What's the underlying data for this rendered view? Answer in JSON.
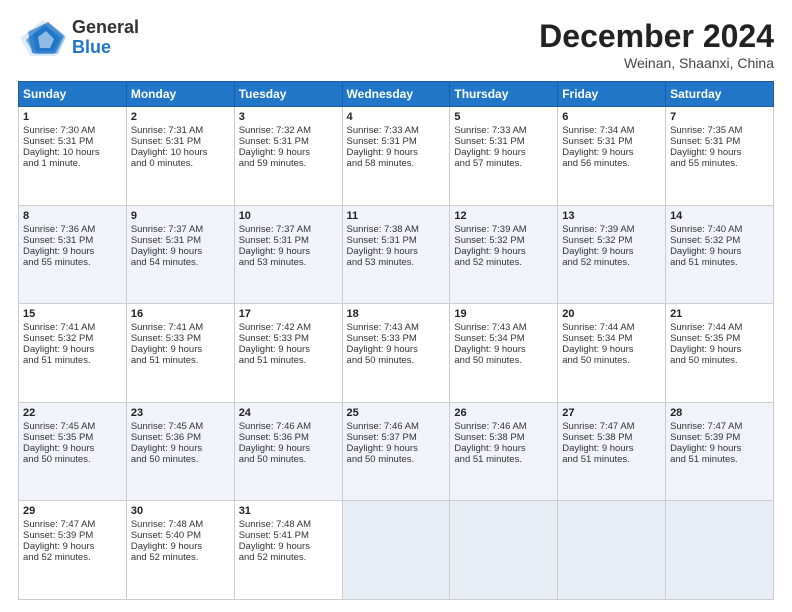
{
  "header": {
    "logo_general": "General",
    "logo_blue": "Blue",
    "month_title": "December 2024",
    "location": "Weinan, Shaanxi, China"
  },
  "days_of_week": [
    "Sunday",
    "Monday",
    "Tuesday",
    "Wednesday",
    "Thursday",
    "Friday",
    "Saturday"
  ],
  "weeks": [
    [
      {
        "day": "1",
        "lines": [
          "Sunrise: 7:30 AM",
          "Sunset: 5:31 PM",
          "Daylight: 10 hours",
          "and 1 minute."
        ]
      },
      {
        "day": "2",
        "lines": [
          "Sunrise: 7:31 AM",
          "Sunset: 5:31 PM",
          "Daylight: 10 hours",
          "and 0 minutes."
        ]
      },
      {
        "day": "3",
        "lines": [
          "Sunrise: 7:32 AM",
          "Sunset: 5:31 PM",
          "Daylight: 9 hours",
          "and 59 minutes."
        ]
      },
      {
        "day": "4",
        "lines": [
          "Sunrise: 7:33 AM",
          "Sunset: 5:31 PM",
          "Daylight: 9 hours",
          "and 58 minutes."
        ]
      },
      {
        "day": "5",
        "lines": [
          "Sunrise: 7:33 AM",
          "Sunset: 5:31 PM",
          "Daylight: 9 hours",
          "and 57 minutes."
        ]
      },
      {
        "day": "6",
        "lines": [
          "Sunrise: 7:34 AM",
          "Sunset: 5:31 PM",
          "Daylight: 9 hours",
          "and 56 minutes."
        ]
      },
      {
        "day": "7",
        "lines": [
          "Sunrise: 7:35 AM",
          "Sunset: 5:31 PM",
          "Daylight: 9 hours",
          "and 55 minutes."
        ]
      }
    ],
    [
      {
        "day": "8",
        "lines": [
          "Sunrise: 7:36 AM",
          "Sunset: 5:31 PM",
          "Daylight: 9 hours",
          "and 55 minutes."
        ]
      },
      {
        "day": "9",
        "lines": [
          "Sunrise: 7:37 AM",
          "Sunset: 5:31 PM",
          "Daylight: 9 hours",
          "and 54 minutes."
        ]
      },
      {
        "day": "10",
        "lines": [
          "Sunrise: 7:37 AM",
          "Sunset: 5:31 PM",
          "Daylight: 9 hours",
          "and 53 minutes."
        ]
      },
      {
        "day": "11",
        "lines": [
          "Sunrise: 7:38 AM",
          "Sunset: 5:31 PM",
          "Daylight: 9 hours",
          "and 53 minutes."
        ]
      },
      {
        "day": "12",
        "lines": [
          "Sunrise: 7:39 AM",
          "Sunset: 5:32 PM",
          "Daylight: 9 hours",
          "and 52 minutes."
        ]
      },
      {
        "day": "13",
        "lines": [
          "Sunrise: 7:39 AM",
          "Sunset: 5:32 PM",
          "Daylight: 9 hours",
          "and 52 minutes."
        ]
      },
      {
        "day": "14",
        "lines": [
          "Sunrise: 7:40 AM",
          "Sunset: 5:32 PM",
          "Daylight: 9 hours",
          "and 51 minutes."
        ]
      }
    ],
    [
      {
        "day": "15",
        "lines": [
          "Sunrise: 7:41 AM",
          "Sunset: 5:32 PM",
          "Daylight: 9 hours",
          "and 51 minutes."
        ]
      },
      {
        "day": "16",
        "lines": [
          "Sunrise: 7:41 AM",
          "Sunset: 5:33 PM",
          "Daylight: 9 hours",
          "and 51 minutes."
        ]
      },
      {
        "day": "17",
        "lines": [
          "Sunrise: 7:42 AM",
          "Sunset: 5:33 PM",
          "Daylight: 9 hours",
          "and 51 minutes."
        ]
      },
      {
        "day": "18",
        "lines": [
          "Sunrise: 7:43 AM",
          "Sunset: 5:33 PM",
          "Daylight: 9 hours",
          "and 50 minutes."
        ]
      },
      {
        "day": "19",
        "lines": [
          "Sunrise: 7:43 AM",
          "Sunset: 5:34 PM",
          "Daylight: 9 hours",
          "and 50 minutes."
        ]
      },
      {
        "day": "20",
        "lines": [
          "Sunrise: 7:44 AM",
          "Sunset: 5:34 PM",
          "Daylight: 9 hours",
          "and 50 minutes."
        ]
      },
      {
        "day": "21",
        "lines": [
          "Sunrise: 7:44 AM",
          "Sunset: 5:35 PM",
          "Daylight: 9 hours",
          "and 50 minutes."
        ]
      }
    ],
    [
      {
        "day": "22",
        "lines": [
          "Sunrise: 7:45 AM",
          "Sunset: 5:35 PM",
          "Daylight: 9 hours",
          "and 50 minutes."
        ]
      },
      {
        "day": "23",
        "lines": [
          "Sunrise: 7:45 AM",
          "Sunset: 5:36 PM",
          "Daylight: 9 hours",
          "and 50 minutes."
        ]
      },
      {
        "day": "24",
        "lines": [
          "Sunrise: 7:46 AM",
          "Sunset: 5:36 PM",
          "Daylight: 9 hours",
          "and 50 minutes."
        ]
      },
      {
        "day": "25",
        "lines": [
          "Sunrise: 7:46 AM",
          "Sunset: 5:37 PM",
          "Daylight: 9 hours",
          "and 50 minutes."
        ]
      },
      {
        "day": "26",
        "lines": [
          "Sunrise: 7:46 AM",
          "Sunset: 5:38 PM",
          "Daylight: 9 hours",
          "and 51 minutes."
        ]
      },
      {
        "day": "27",
        "lines": [
          "Sunrise: 7:47 AM",
          "Sunset: 5:38 PM",
          "Daylight: 9 hours",
          "and 51 minutes."
        ]
      },
      {
        "day": "28",
        "lines": [
          "Sunrise: 7:47 AM",
          "Sunset: 5:39 PM",
          "Daylight: 9 hours",
          "and 51 minutes."
        ]
      }
    ],
    [
      {
        "day": "29",
        "lines": [
          "Sunrise: 7:47 AM",
          "Sunset: 5:39 PM",
          "Daylight: 9 hours",
          "and 52 minutes."
        ]
      },
      {
        "day": "30",
        "lines": [
          "Sunrise: 7:48 AM",
          "Sunset: 5:40 PM",
          "Daylight: 9 hours",
          "and 52 minutes."
        ]
      },
      {
        "day": "31",
        "lines": [
          "Sunrise: 7:48 AM",
          "Sunset: 5:41 PM",
          "Daylight: 9 hours",
          "and 52 minutes."
        ]
      },
      null,
      null,
      null,
      null
    ]
  ]
}
